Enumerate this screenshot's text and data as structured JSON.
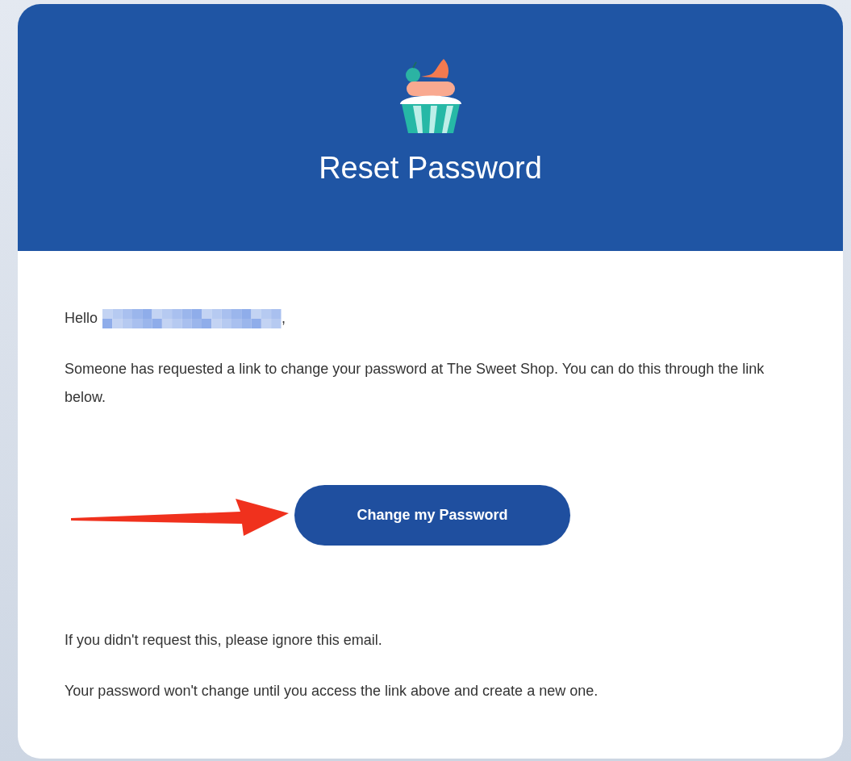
{
  "header": {
    "title": "Reset Password"
  },
  "greeting": {
    "prefix": "Hello",
    "suffix": ","
  },
  "paragraphs": [
    "Someone has requested a link to change your password at The Sweet Shop. You can do this through the link below."
  ],
  "button": {
    "label": "Change my Password"
  },
  "footer_paragraphs": [
    "If you didn't request this, please ignore this email.",
    "Your password won't change until you access the link above and create a new one."
  ]
}
